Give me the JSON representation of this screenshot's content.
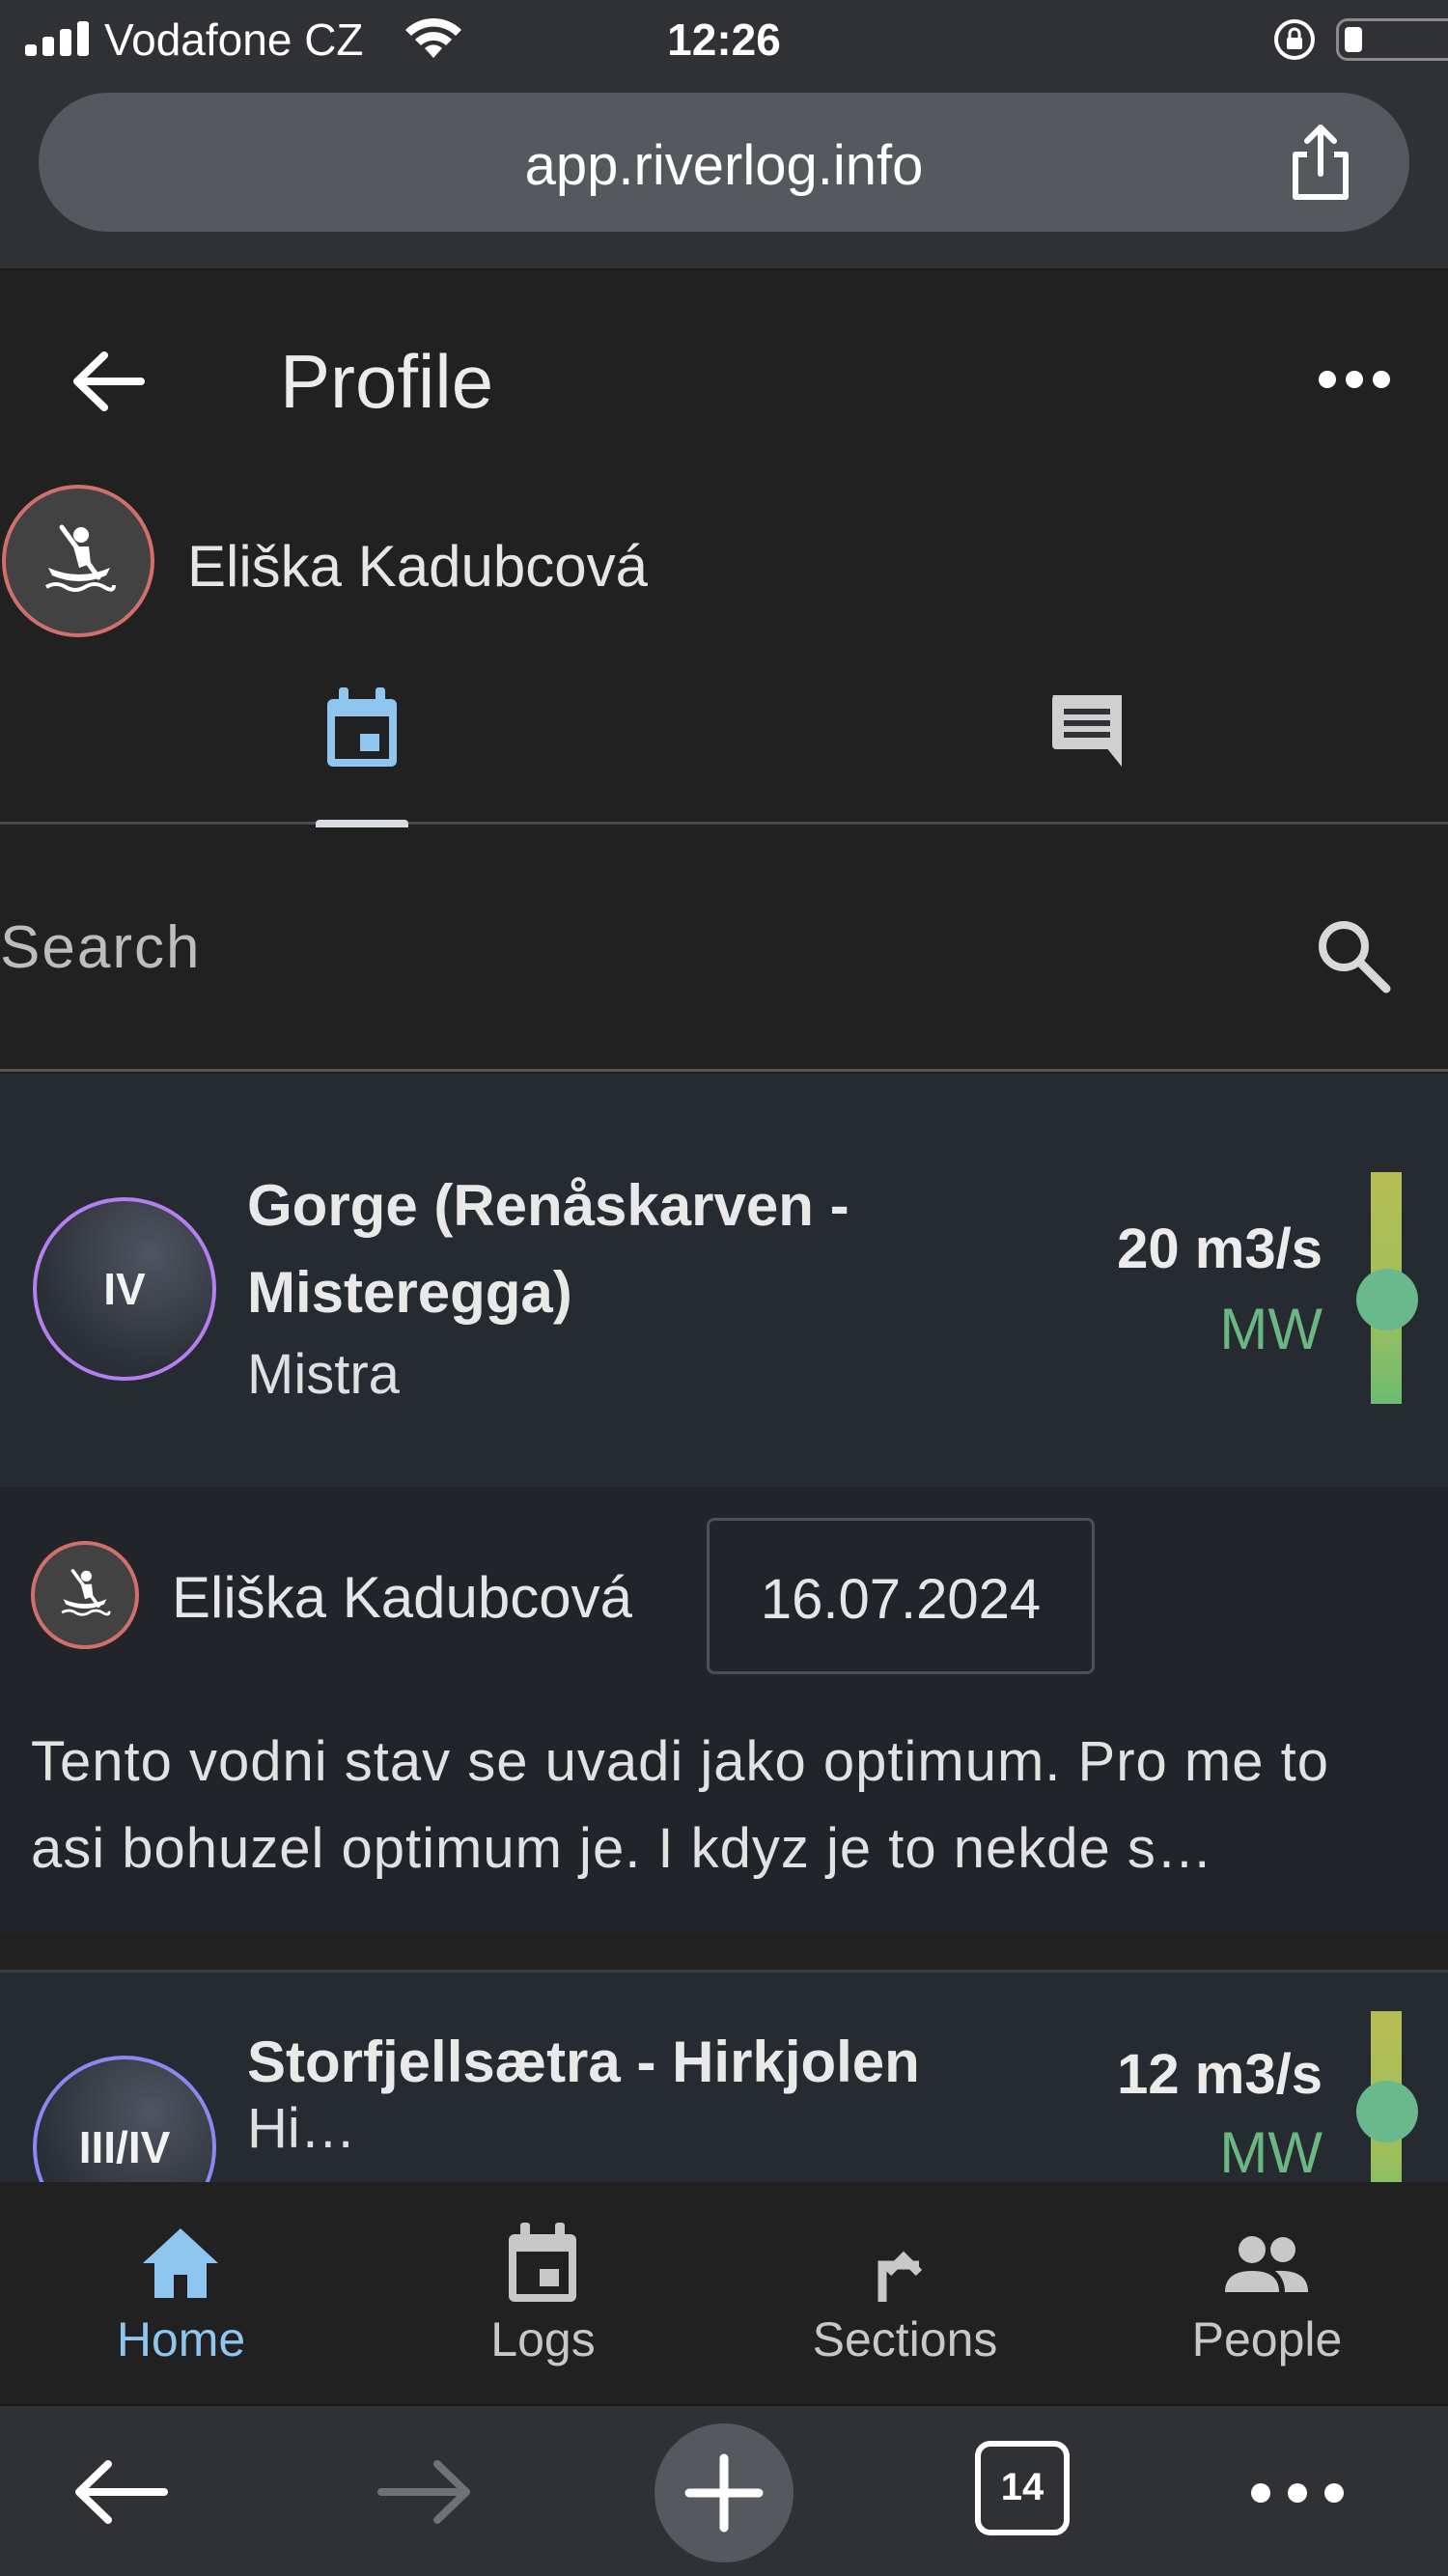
{
  "status_bar": {
    "carrier": "Vodafone CZ",
    "time": "12:26",
    "battery_level": 0.12
  },
  "browser": {
    "url": "app.riverlog.info",
    "tab_count": "14"
  },
  "header": {
    "title": "Profile"
  },
  "profile": {
    "name": "Eliška Kadubcová",
    "avatar_icon": "kayaker-icon",
    "avatar_ring_color": "#d16f6a"
  },
  "tabs": [
    {
      "name": "logs",
      "icon": "calendar-icon",
      "active": true
    },
    {
      "name": "comments",
      "icon": "comment-icon",
      "active": false
    }
  ],
  "search": {
    "placeholder": "Search"
  },
  "logs": [
    {
      "grade": "IV",
      "grade_color": "#b57ff0",
      "section": "Gorge (Renåskarven - Misteregga)",
      "river": "Mistra",
      "flow": "20 m3/s",
      "level": "MW",
      "level_color": "#6ab782",
      "author": "Eliška Kadubcová",
      "date": "16.07.2024",
      "note": "Tento vodni stav se uvadi jako optimum. Pro me to asi bohuzel optimum je. I kdyz je to nekde s…"
    },
    {
      "grade": "III/IV",
      "grade_color": "#8c88f2",
      "section": "Storfjellsætra - Hirkjolen",
      "river": "Hi…",
      "flow": "12 m3/s",
      "level": "MW",
      "level_color": "#6ab782"
    }
  ],
  "nav": [
    {
      "label": "Home",
      "icon": "home-icon",
      "active": true
    },
    {
      "label": "Logs",
      "icon": "calendar-icon",
      "active": false
    },
    {
      "label": "Sections",
      "icon": "turn-right-icon",
      "active": false
    },
    {
      "label": "People",
      "icon": "people-icon",
      "active": false
    }
  ],
  "colors": {
    "accent": "#8fc6f0",
    "background": "#212121",
    "card": "#262a31"
  }
}
